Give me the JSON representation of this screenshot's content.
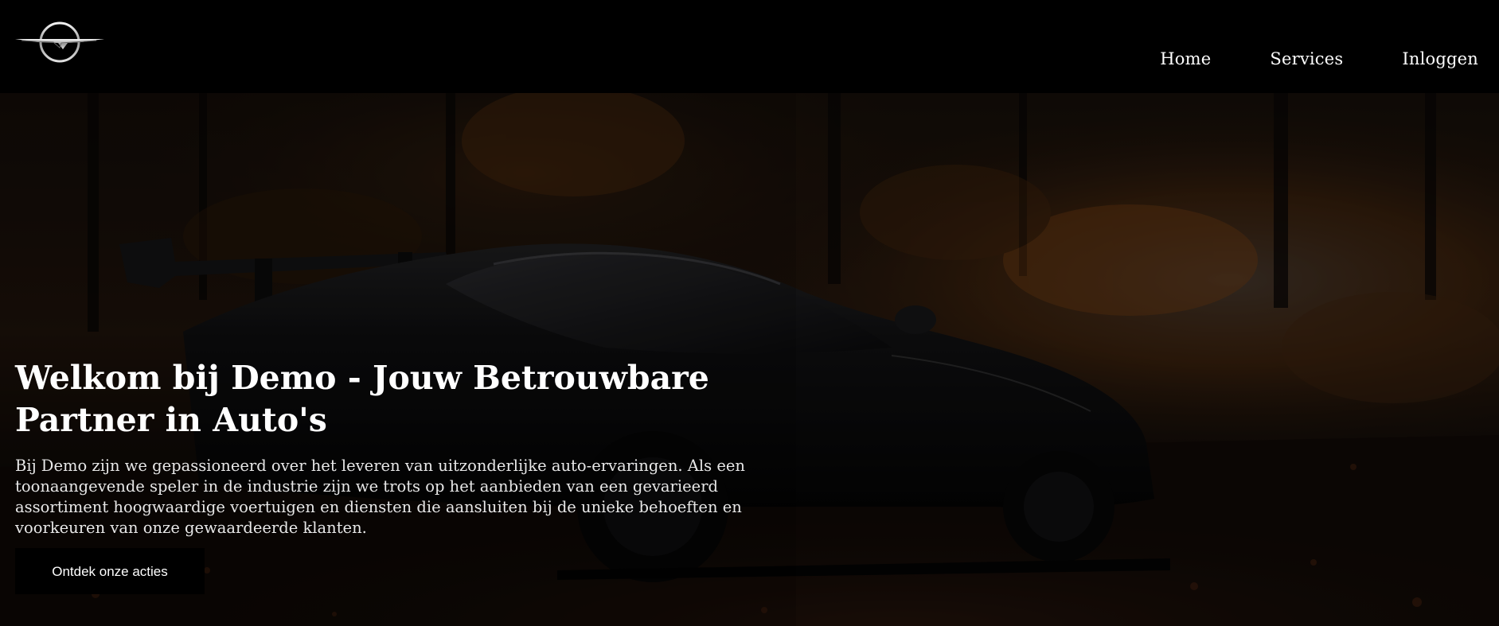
{
  "header": {
    "logo_icon": "brand-wing-logo-icon",
    "nav": [
      {
        "label": "Home"
      },
      {
        "label": "Services"
      },
      {
        "label": "Inloggen"
      }
    ]
  },
  "hero": {
    "background": "dark photo of black supercar on autumn forest road",
    "title": "Welkom bij Demo - Jouw Betrouwbare Partner in Auto's",
    "text": "Bij Demo zijn we gepassioneerd over het leveren van uitzonderlijke auto-ervaringen. Als een toonaangevende speler in de industrie zijn we trots op het aanbieden van een gevarieerd assortiment hoogwaardige voertuigen en diensten die aansluiten bij de unieke behoeften en voorkeuren van onze gewaardeerde klanten.",
    "cta_label": "Ontdek onze acties"
  },
  "colors": {
    "header_bg": "#000000",
    "text": "#ffffff",
    "button_bg": "#000000",
    "autumn_accent": "#7a3a10"
  }
}
